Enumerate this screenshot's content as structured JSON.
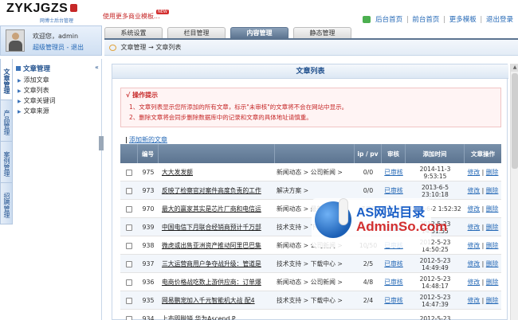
{
  "header": {
    "logo": "ZYKJGZS",
    "logo_sub": "网博士后台管理",
    "promo": "使用更多商业模板...",
    "promo_badge": "NEW",
    "links": [
      "后台首页",
      "前台首页",
      "更多模板",
      "退出登录"
    ]
  },
  "tabs": [
    "系统设置",
    "栏目管理",
    "内容管理",
    "静态管理"
  ],
  "active_tab": "内容管理",
  "user": {
    "welcome": "欢迎您，admin",
    "role": "超级管理员",
    "logout": "退出"
  },
  "breadcrumb": [
    "文章管理",
    "文章列表"
  ],
  "breadcrumb_sep": "→",
  "vtabs": [
    "文章管理",
    "产品管理",
    "案例管理",
    "招聘管理"
  ],
  "sidebar": {
    "title": "文章管理",
    "collapse": "«",
    "items": [
      "添加文章",
      "文章列表",
      "文章关键词",
      "文章来源"
    ]
  },
  "panel_title": "文章列表",
  "tips": {
    "title": "√ 操作提示",
    "lines": [
      "1、文章列表显示您所添加的所有文章，标示\"未审核\"的文章将不会在网站中显示。",
      "2、删除文章将会同步删除数据库中的记录和文章的具体地址请慎重。"
    ]
  },
  "add_link": "添加新的文章",
  "table": {
    "headers": [
      "",
      "编号",
      "",
      "",
      "ip / pv",
      "审核",
      "添加时间",
      "文章操作"
    ],
    "rows": [
      {
        "id": "975",
        "title": "大大发发额",
        "cat": "新闻动态 > 公司新闻 >",
        "ippv": "0/0",
        "status": "已审核",
        "time": [
          "2014-11-3",
          "9:53:15"
        ]
      },
      {
        "id": "973",
        "title": "反映了检察官对案件高度负责的工作",
        "cat": "解决方案 >",
        "ippv": "0/0",
        "status": "已审核",
        "time": [
          "2013-6-5",
          "23:10:18"
        ]
      },
      {
        "id": "970",
        "title": "最大的赢家其实是芯片厂商和电信运",
        "cat": "新闻动态 > 最新活动 >",
        "ippv": "7/26",
        "status": "已审核",
        "time": [
          "2013-6-2 1:52:32"
        ]
      },
      {
        "id": "939",
        "title": "中国电信下月联合经销商预计千万部",
        "cat": "技术支持 > 下载中心 >",
        "ippv": "6/13",
        "status": "已审核",
        "time": [
          "2012-5-23",
          "14:51:55"
        ]
      },
      {
        "id": "938",
        "title": "微虎或出售亚洲资产推动阿里巴巴集",
        "cat": "新闻动态 > 公司新闻 >",
        "ippv": "10/50",
        "status": "已审核",
        "time": [
          "2012-5-23",
          "14:50:25"
        ]
      },
      {
        "id": "937",
        "title": "三大运营商用户争夺战升级：管道是",
        "cat": "技术支持 > 下载中心 >",
        "ippv": "2/5",
        "status": "已审核",
        "time": [
          "2012-5-23",
          "14:49:49"
        ]
      },
      {
        "id": "936",
        "title": "电商价格战吃数上游供应商：订单爆",
        "cat": "新闻动态 > 公司新闻 >",
        "ippv": "4/8",
        "status": "已审核",
        "time": [
          "2012-5-23",
          "14:48:17"
        ]
      },
      {
        "id": "935",
        "title": "网易鹏宠加入千元智能机大战 配4",
        "cat": "技术支持 > 下载中心 >",
        "ippv": "2/4",
        "status": "已审核",
        "time": [
          "2012-5-23",
          "14:47:39"
        ]
      },
      {
        "id": "934",
        "title": "上市即脱销 华为Ascend P",
        "cat": "",
        "ippv": "",
        "status": "",
        "time": [
          "2012-5-23"
        ]
      }
    ],
    "op_edit": "修改",
    "op_delete": "删除"
  },
  "watermark": {
    "line1": "AS网站目录",
    "line2": "AdminSo.com"
  },
  "colors": {
    "accent": "#5c7490",
    "link": "#2468b6",
    "warning": "#c62828"
  }
}
